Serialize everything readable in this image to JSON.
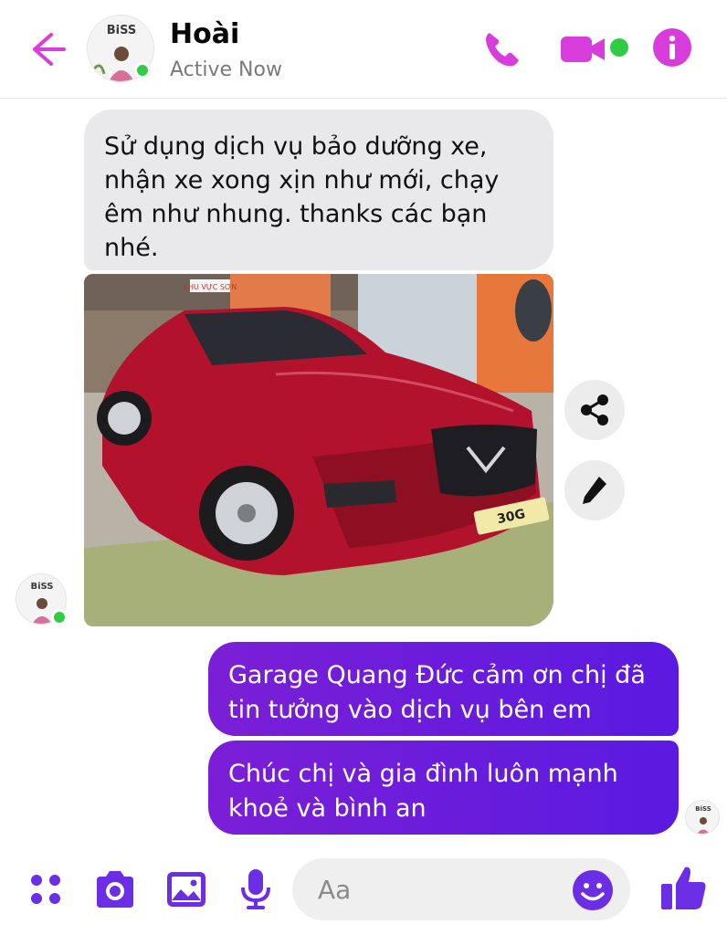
{
  "header": {
    "contact_name": "Hoài",
    "status": "Active Now",
    "avatar_brand": "BiSS"
  },
  "messages": {
    "incoming_text": "Sử dụng dịch vụ bảo dưỡng xe,\nnhận xe xong xịn như mới, chạy\nêm như nhung. thanks các bạn\nnhé.",
    "outgoing_1": "Garage Quang Đức cảm ơn chị đã\ntin tưởng vào dịch vụ bên em",
    "outgoing_2": "Chúc chị và gia đình luôn mạnh\nkhoẻ và bình an"
  },
  "photo": {
    "sign_text": "KHU VỰC SƠN",
    "plate_text": "30G"
  },
  "composer": {
    "placeholder": "Aa"
  },
  "icons": {
    "back": "back-arrow-icon",
    "call": "phone-icon",
    "video": "video-camera-icon",
    "info": "info-icon",
    "share": "share-icon",
    "edit": "pencil-icon",
    "menu": "four-dots-icon",
    "camera": "camera-icon",
    "gallery": "image-icon",
    "mic": "microphone-icon",
    "emoji": "smiley-icon",
    "like": "thumbs-up-icon"
  },
  "colors": {
    "accent": "#d83ddc",
    "composer_accent": "#6b2ee4",
    "outgoing_bubble": "#6a1fdc",
    "incoming_bubble": "#e9e9eb",
    "presence": "#31cc46"
  }
}
